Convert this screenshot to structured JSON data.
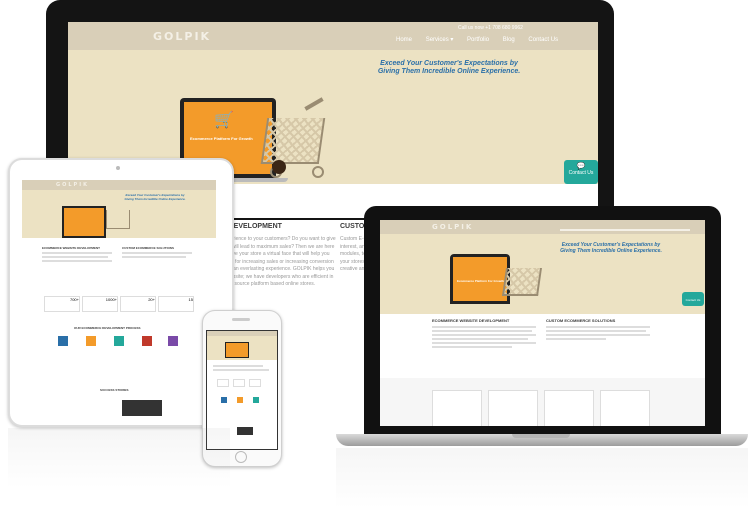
{
  "desktop": {
    "logo": "GOLPIK",
    "phone": "Call us now +1 708 680 9962",
    "nav": [
      "Home",
      "Services ▾",
      "Portfolio",
      "Blog",
      "Contact Us"
    ],
    "hero_line1": "Exceed Your Customer's Expectations by",
    "hero_line2": "Giving Them Incredible Online Experience.",
    "illustration_title": "Ecommerce Platform For Growth",
    "contact_tab": "Contact Us",
    "section_left_title": "E DEVELOPMENT",
    "section_right_title": "CUSTOM",
    "para_lines": [
      "experience to your customers? Do you want to give",
      "that will lead to maximum sales? Then we are here",
      "ce give your store a virtual face that will help you",
      "nities for increasing sales or increasing conversion",
      "ners an everlasting experience. GOLPIK helps you",
      "e website; we have developers who are efficient in",
      "open source platform based online stores."
    ],
    "right_lines": [
      "Custom E-Co",
      "interest, and",
      "modules, tem",
      "your stores,",
      "creative and"
    ]
  },
  "tablet": {
    "logo": "GOLPIK",
    "hero_line1": "Exceed Your Customer's Expectations by",
    "hero_line2": "Giving Them Incredible Online Experience.",
    "col1": "ECOMMERCE WEBSITE DEVELOPMENT",
    "col2": "CUSTOM ECOMMERCE SOLUTIONS",
    "stats": [
      "700+",
      "1000+",
      "20+",
      "15"
    ],
    "process_title": "OUR ECOMMERCE DEVELOPMENT PROCESS",
    "success_title": "SUCCESS STORIES"
  },
  "laptop": {
    "logo": "GOLPIK",
    "hero_line1": "Exceed Your Customer's Expectations by",
    "hero_line2": "Giving Them Incredible Online Experience.",
    "illustration_title": "Ecommerce Platform For Growth",
    "contact_tab": "Contact Us",
    "col1": "ECOMMERCE WEBSITE DEVELOPMENT",
    "col2": "CUSTOM ECOMMERCE SOLUTIONS"
  },
  "colors": {
    "accent_blue": "#2a6fa8",
    "teal": "#24a89b",
    "orange": "#f39b2a",
    "hero_beige": "#ece2c3",
    "header_tan": "#d9cfb8"
  }
}
